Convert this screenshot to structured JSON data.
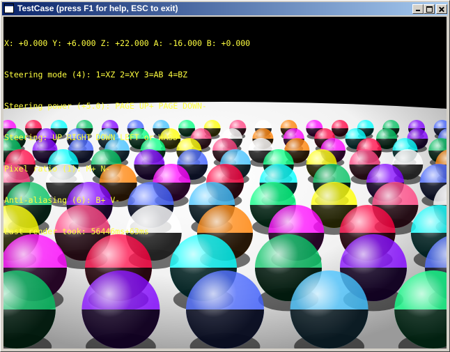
{
  "window": {
    "title": "TestCase (press F1 for help, ESC to exit)",
    "controls": {
      "minimize_icon": "minimize-icon",
      "maximize_icon": "maximize-icon",
      "close_icon": "close-icon"
    }
  },
  "hud": {
    "lines": [
      "X: +0.000 Y: +6.000 Z: +22.000 A: -16.000 B: +0.000",
      "Steering mode (4): 1=XZ 2=XY 3=AB 4=BZ",
      "Steering power (+5.0): PAGE UP+ PAGE DOWN-",
      "Steering: UP RIGHT DOWN LEFT or WASD",
      "Pixel ratio (1): M+ N-",
      "Anti-aliasing (6): B+ V-",
      "Last render took: 56446ms+63ms"
    ],
    "color": "#ffff40"
  },
  "scene": {
    "background": "#000000",
    "floor_color": "#ffffff",
    "sphere_palette": [
      "#ff00ff",
      "#00ff80",
      "#00ffff",
      "#ff4080",
      "#8000ff",
      "#ff8000",
      "#40c0ff",
      "#ff0040",
      "#ffff00",
      "#00c060",
      "#ffffff",
      "#4060ff"
    ]
  }
}
